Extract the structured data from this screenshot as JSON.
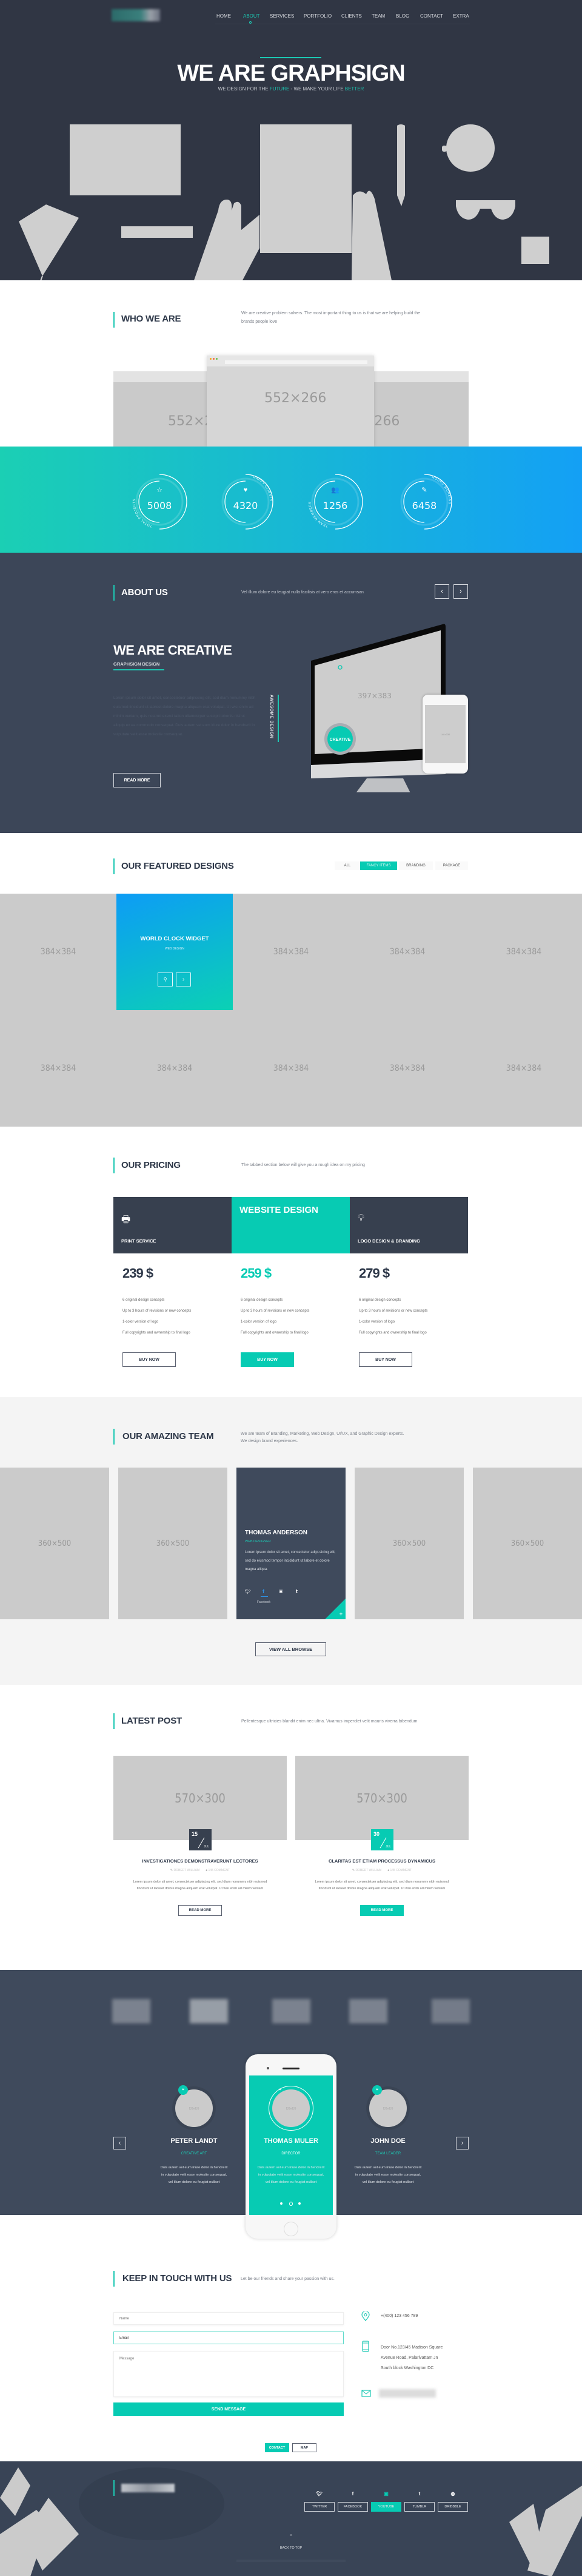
{
  "colors": {
    "accent": "#07cbb3",
    "dark": "#303644",
    "navy": "#3c4658",
    "gradient_start": "#1bcfb4",
    "gradient_end": "#14a0f5"
  },
  "nav": {
    "items": [
      "HOME",
      "ABOUT",
      "SERVICES",
      "PORTFOLIO",
      "CLIENTS",
      "TEAM",
      "BLOG",
      "CONTACT",
      "EXTRA"
    ],
    "active": "ABOUT"
  },
  "hero": {
    "title": "WE ARE GRAPHSIGN",
    "subtitle_a": "WE DESIGN FOR THE ",
    "subtitle_hl1": "FUTURE",
    "subtitle_b": " - WE MAKE YOUR LIFE ",
    "subtitle_hl2": "BETTER"
  },
  "who": {
    "title": "WHO WE ARE",
    "desc": "We are creative problem solvers. The most important thing to us is that we are helping build the brands people love",
    "mockups": [
      "552×266",
      "552×266",
      "552×266"
    ]
  },
  "counters": [
    {
      "icon": "star-icon",
      "value": "5008",
      "label": "TOTAL PROJECTS"
    },
    {
      "icon": "heart-icon",
      "value": "4320",
      "label": "HAPPY CLIENTS"
    },
    {
      "icon": "users-icon",
      "value": "1256",
      "label": "TEAM MEMBERS"
    },
    {
      "icon": "pencil-icon",
      "value": "6458",
      "label": "HOURS WORKING"
    }
  ],
  "about": {
    "title": "ABOUT US",
    "desc": "Vel illum dolore eu feugiat nulla facilisis at vero eros et accumsan",
    "heading": "WE ARE CREATIVE",
    "subheading": "GRAPHSIGN DESIGN",
    "body": "Lorem ipsum dolor sit amet, consectetuer adipiscing elit, sed diam nonummy nibh euismod tincidunt ut laoreet dolore magna aliquam erat volutpat. Ut wisi enim ad minim veniam, quis nostrud exerci tation ullamcorper suscipit lobortis nisl ut aliquip ex ea commodo consequat. Duis autem vel eum iriure dolor in hendrerit in vulputate velit esse molestie consequat.",
    "vertical_label": "AWESOME DESIGN",
    "read_more": "READ MORE",
    "badge": "CREATIVE",
    "screen": "397×383",
    "phone_screen": "148×336"
  },
  "featured": {
    "title": "OUR FEATURED DESIGNS",
    "filters": [
      "ALL",
      "FANCY ITEMS",
      "BRANDING",
      "PACKAGE"
    ],
    "active_filter": "FANCY ITEMS",
    "placeholder": "384×384",
    "card": {
      "title": "WORLD CLOCK WIDGET",
      "category": "WEB DESIGN"
    }
  },
  "pricing": {
    "title": "OUR PRICING",
    "desc": "The tabbed section below will give you a rough idea on my pricing",
    "plans": [
      {
        "name": "PRINT SERVICE",
        "icon": "printer-icon",
        "price": "239 $",
        "features": [
          "6 original design concepts",
          "Up to 3 hours of revisions or new concepts",
          "1-color version of logo",
          "Full copyrights and ownership to final logo"
        ],
        "button": "BUY NOW",
        "featured": false
      },
      {
        "name": "WEBSITE DESIGN",
        "icon": "rocket-icon",
        "price": "259 $",
        "features": [
          "6 original design concepts",
          "Up to 3 hours of revisions or new concepts",
          "1-color version of logo",
          "Full copyrights and ownership to final logo"
        ],
        "button": "BUY NOW",
        "featured": true
      },
      {
        "name": "LOGO DESIGN & BRANDING",
        "icon": "lightbulb-icon",
        "price": "279 $",
        "features": [
          "6 original design concepts",
          "Up to 3 hours of revisions or new concepts",
          "1-color version of logo",
          "Full copyrights and ownership to final logo"
        ],
        "button": "BUY NOW",
        "featured": false
      }
    ]
  },
  "team": {
    "title": "OUR AMAZING TEAM",
    "desc_1": "We are team of Branding, Marketing, Web Design, UI/UX, and Graphic Design experts.",
    "desc_2": "We design brand experiences.",
    "placeholder": "360×500",
    "member": {
      "name": "THOMAS ANDERSON",
      "role": "WEB DESIGNER",
      "bio": "Lorem ipsum dolor sit amet, consectetur adipi-sicing elit, sed do eiusmod tempor incididunt ut labore et dolore magna aliqua.",
      "social_label": "Facebook"
    },
    "view_all": "VIEW ALL BROWSE"
  },
  "blog": {
    "title": "LATEST POST",
    "desc": "Pellentesque ultricies blandit enim nec ultria. Vivamus imperdiet velit mauris viverra bibendum",
    "posts": [
      {
        "image": "570×300",
        "day": "15",
        "month": "JUL",
        "title": "INVESTIGATIONES DEMONSTRAVERUNT LECTORES",
        "author": "ROBERT WILLIAM",
        "comments": "145 COMMENT",
        "excerpt": "Lorem ipsum dolor sit amet, consectetuer adipiscing elit, sed diam nonummy nibh euismod tincidunt ut laoreet dolore magna aliquam erat volutpat. Ut wisi enim ad minim veniam",
        "button": "READ MORE"
      },
      {
        "image": "570×300",
        "day": "30",
        "month": "JUL",
        "title": "CLARITAS EST ETIAM PROCESSUS DYNAMICUS",
        "author": "ROBERT WILLIAM",
        "comments": "145 COMMENT",
        "excerpt": "Lorem ipsum dolor sit amet, consectetuer adipiscing elit, sed diam nonummy nibh euismod tincidunt ut laoreet dolore magna aliquam erat volutpat. Ut wisi enim ad minim veniam",
        "button": "READ MORE"
      }
    ]
  },
  "testimonials": {
    "items": [
      {
        "name": "PETER LANDT",
        "role": "CREATIVE ART",
        "text": "Duis autem vel eum iriure dolor in hendrerit in vulputate velit esse molestie consequat, vel illum dolore eu feugiat nullaet",
        "avatar": "125×125"
      },
      {
        "name": "THOMAS MULER",
        "role": "DIRECTOR",
        "text": "Duis autem vel eum iriure dolor in hendrerit in vulputate velit esse molestie consequat, vel illum dolore eu feugiat nullaet",
        "avatar": "125×125"
      },
      {
        "name": "JOHN DOE",
        "role": "TEAM LEADER",
        "text": "Duis autem vel eum iriure dolor in hendrerit in vulputate velit esse molestie consequat, vel illum dolore eu feugiat nullaet",
        "avatar": "125×125"
      }
    ],
    "active_index": 1
  },
  "contact": {
    "title": "KEEP IN TOUCH WITH US",
    "desc": "Let be our friends and share your passion with us.",
    "name_placeholder": "Name",
    "email_value": "Email",
    "message_placeholder": "Message",
    "send": "SEND MESSAGE",
    "phone": "+(400) 123 456 789",
    "address": [
      "Door No.123/45 Madison Square",
      "Avenue Road, Palarivattam Jn",
      "South block Washington DC"
    ],
    "tabs": [
      "CONTACT",
      "MAP"
    ],
    "active_tab": "CONTACT"
  },
  "footer": {
    "social": [
      {
        "icon": "twitter-icon",
        "label": "TWITTER"
      },
      {
        "icon": "facebook-icon",
        "label": "FACEBOOK"
      },
      {
        "icon": "youtube-icon",
        "label": "YOUTUBE"
      },
      {
        "icon": "tumblr-icon",
        "label": "TUMBLR"
      },
      {
        "icon": "dribbble-icon",
        "label": "DRIBBBLE"
      }
    ],
    "active_social": "YOUTUBE",
    "back_to_top": "BACK TO TOP"
  }
}
